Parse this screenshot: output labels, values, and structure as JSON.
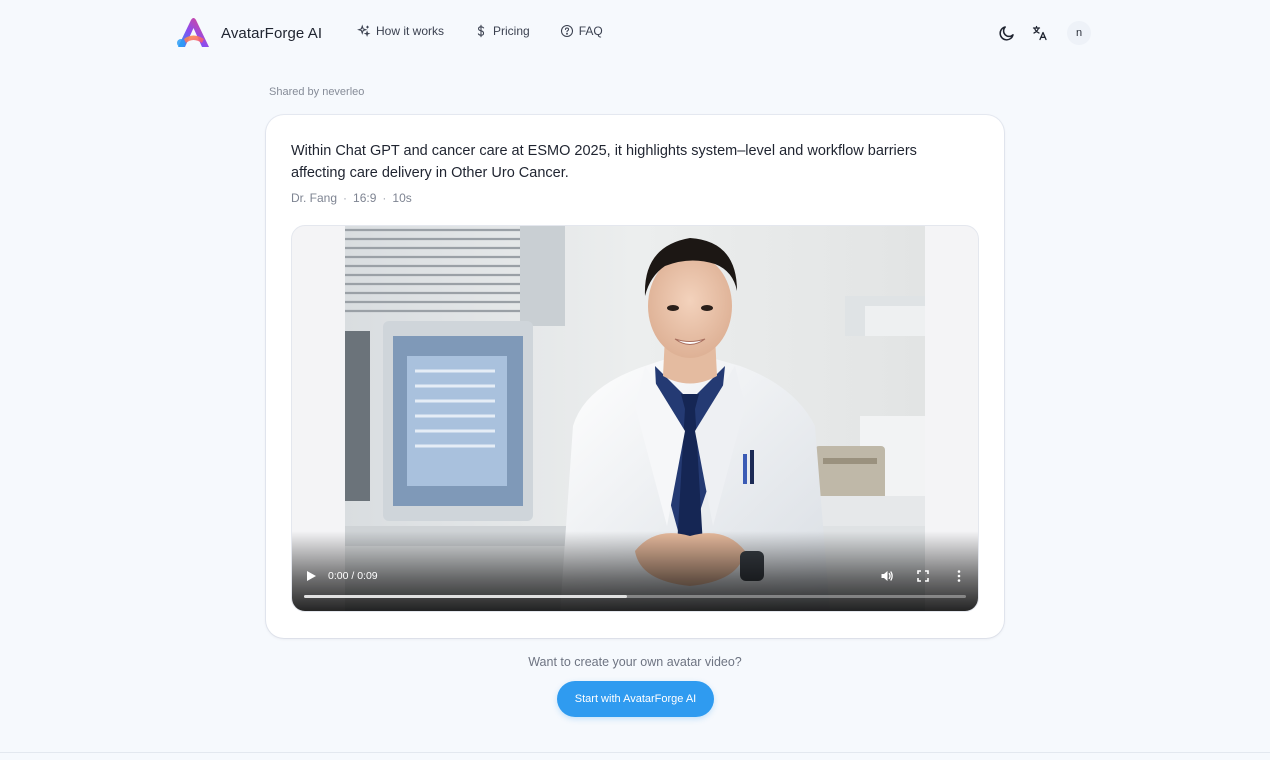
{
  "header": {
    "brand_name": "AvatarForge AI",
    "nav": [
      {
        "label": "How it works",
        "icon": "sparkles-icon"
      },
      {
        "label": "Pricing",
        "icon": "dollar-icon"
      },
      {
        "label": "FAQ",
        "icon": "help-circle-icon"
      }
    ],
    "theme_icon": "moon-icon",
    "translate_icon": "translate-icon",
    "avatar_initial": "n"
  },
  "shared_by": "Shared by neverleo",
  "card": {
    "title": "Within Chat GPT and cancer care at ESMO 2025, it highlights system–level and workflow barriers affecting care delivery in Other Uro Cancer.",
    "meta": {
      "author": "Dr. Fang",
      "aspect": "16:9",
      "duration": "10s"
    }
  },
  "video": {
    "time_display": "0:00 / 0:09",
    "progress_fraction": 0,
    "buffered_fraction": 0.488
  },
  "cta": {
    "prompt": "Want to create your own avatar video?",
    "button_label": "Start with AvatarForge AI"
  },
  "colors": {
    "accent": "#2f9bf0",
    "background": "#f6f9fd"
  }
}
